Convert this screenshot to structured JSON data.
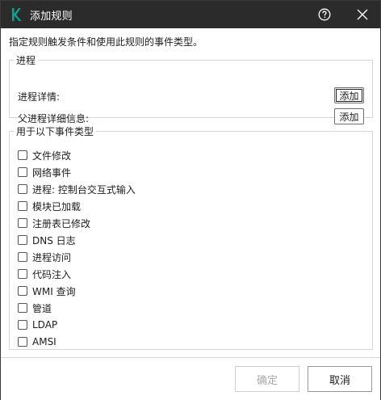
{
  "window": {
    "title": "添加规则"
  },
  "description": "指定规则触发条件和使用此规则的事件类型。",
  "process_group": {
    "legend": "进程",
    "process_details_label": "进程详情:",
    "parent_process_details_label": "父进程详细信息:",
    "add_label": "添加"
  },
  "event_types": {
    "legend": "用于以下事件类型",
    "items": [
      "文件修改",
      "网络事件",
      "进程: 控制台交互式输入",
      "模块已加载",
      "注册表已修改",
      "DNS 日志",
      "进程访问",
      "代码注入",
      "WMI 查询",
      "管道",
      "LDAP",
      "AMSI"
    ]
  },
  "footer": {
    "ok_label": "确定",
    "cancel_label": "取消"
  },
  "colors": {
    "titlebar": "#2b2b2b",
    "logo": "#00a88e"
  },
  "icons": [
    "kaspersky-logo-icon",
    "help-icon",
    "close-icon"
  ]
}
